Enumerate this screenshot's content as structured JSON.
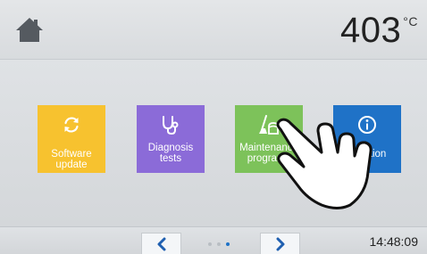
{
  "header": {
    "temperature": "403",
    "temperature_unit": "°C"
  },
  "tiles": [
    {
      "label": "Software update",
      "icon": "refresh-icon",
      "color": "#f7c22f"
    },
    {
      "label": "Diagnosis tests",
      "icon": "stethoscope-icon",
      "color": "#8b6bd8"
    },
    {
      "label": "Maintenance programs",
      "icon": "cleaning-broom-icon",
      "color": "#7dc25a"
    },
    {
      "label": "Information",
      "visible_label": "nation",
      "icon": "info-icon",
      "color": "#1f72c7"
    }
  ],
  "footer": {
    "clock": "14:48:09",
    "page_count": 3,
    "active_page": 3
  },
  "colors": {
    "accent": "#1f72c7"
  }
}
